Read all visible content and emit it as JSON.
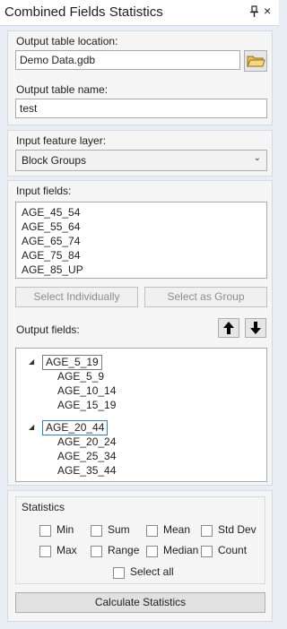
{
  "window": {
    "title": "Combined Fields Statistics"
  },
  "output_table": {
    "location_label": "Output table location:",
    "location_value": "Demo Data.gdb",
    "name_label": "Output table name:",
    "name_value": "test"
  },
  "input_layer": {
    "label": "Input feature layer:",
    "selected": "Block Groups"
  },
  "input_fields": {
    "label": "Input fields:",
    "items": [
      "AGE_45_54",
      "AGE_55_64",
      "AGE_65_74",
      "AGE_75_84",
      "AGE_85_UP"
    ],
    "select_individually": "Select Individually",
    "select_as_group": "Select as Group"
  },
  "output_fields": {
    "label": "Output fields:",
    "groups": [
      {
        "name": "AGE_5_19",
        "children": [
          "AGE_5_9",
          "AGE_10_14",
          "AGE_15_19"
        ]
      },
      {
        "name": "AGE_20_44",
        "children": [
          "AGE_20_24",
          "AGE_25_34",
          "AGE_35_44"
        ]
      }
    ]
  },
  "statistics": {
    "label": "Statistics",
    "options": [
      "Min",
      "Sum",
      "Mean",
      "Std Dev",
      "Max",
      "Range",
      "Median",
      "Count"
    ],
    "select_all": "Select all"
  },
  "calculate_button": "Calculate Statistics",
  "icons": {
    "pin": "pin-icon",
    "close": "close-icon",
    "folder": "folder-icon",
    "dropdown": "chevron-down-icon",
    "up": "arrow-up-icon",
    "down": "arrow-down-icon",
    "tree_toggle": "collapse-triangle-icon"
  },
  "colors": {
    "selected_node_border": "#3c7fb1",
    "folder_yellow": "#e9c25a"
  }
}
